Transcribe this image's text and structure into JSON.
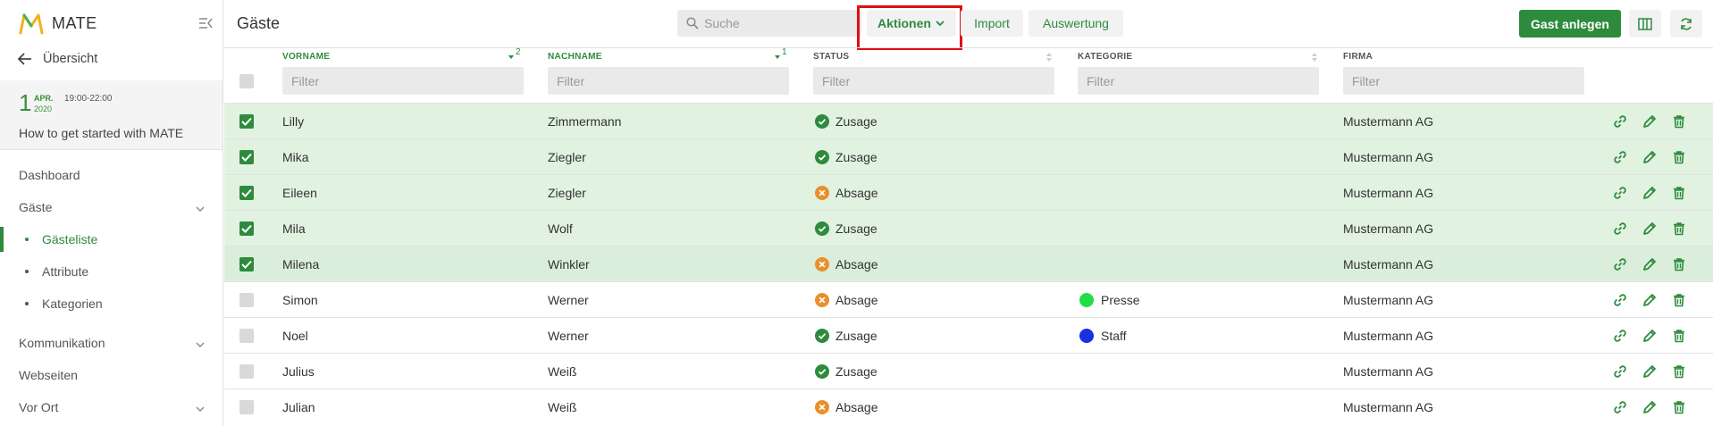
{
  "app": {
    "name": "MATE"
  },
  "sidebar": {
    "back_label": "Übersicht",
    "event": {
      "day": "1",
      "month": "APR.",
      "year": "2020",
      "time": "19:00-22:00",
      "title": "How to get started with MATE"
    },
    "items": [
      {
        "label": "Dashboard"
      },
      {
        "label": "Gäste"
      },
      {
        "label": "Gästeliste"
      },
      {
        "label": "Attribute"
      },
      {
        "label": "Kategorien"
      },
      {
        "label": "Kommunikation"
      },
      {
        "label": "Webseiten"
      },
      {
        "label": "Vor Ort"
      }
    ]
  },
  "header": {
    "title": "Gäste",
    "search_placeholder": "Suche",
    "aktionen_label": "Aktionen",
    "import_label": "Import",
    "auswertung_label": "Auswertung",
    "primary_label": "Gast anlegen"
  },
  "table": {
    "columns": [
      {
        "label": "VORNAME",
        "sort_order": "2"
      },
      {
        "label": "NACHNAME",
        "sort_order": "1"
      },
      {
        "label": "STATUS"
      },
      {
        "label": "KATEGORIE"
      },
      {
        "label": "FIRMA"
      }
    ],
    "filter_placeholder": "Filter",
    "rows": [
      {
        "vorname": "Lilly",
        "nachname": "Zimmermann",
        "status": "Zusage",
        "kategorie": "",
        "firma": "Mustermann AG",
        "selected": true
      },
      {
        "vorname": "Mika",
        "nachname": "Ziegler",
        "status": "Zusage",
        "kategorie": "",
        "firma": "Mustermann AG",
        "selected": true
      },
      {
        "vorname": "Eileen",
        "nachname": "Ziegler",
        "status": "Absage",
        "kategorie": "",
        "firma": "Mustermann AG",
        "selected": true
      },
      {
        "vorname": "Mila",
        "nachname": "Wolf",
        "status": "Zusage",
        "kategorie": "",
        "firma": "Mustermann AG",
        "selected": true
      },
      {
        "vorname": "Milena",
        "nachname": "Winkler",
        "status": "Absage",
        "kategorie": "",
        "firma": "Mustermann AG",
        "selected": true
      },
      {
        "vorname": "Simon",
        "nachname": "Werner",
        "status": "Absage",
        "kategorie": "Presse",
        "firma": "Mustermann AG",
        "selected": false
      },
      {
        "vorname": "Noel",
        "nachname": "Werner",
        "status": "Zusage",
        "kategorie": "Staff",
        "firma": "Mustermann AG",
        "selected": false
      },
      {
        "vorname": "Julius",
        "nachname": "Weiß",
        "status": "Zusage",
        "kategorie": "",
        "firma": "Mustermann AG",
        "selected": false
      },
      {
        "vorname": "Julian",
        "nachname": "Weiß",
        "status": "Absage",
        "kategorie": "",
        "firma": "Mustermann AG",
        "selected": false
      }
    ]
  },
  "colors": {
    "accent": "#2e8b3d",
    "zusage": "#2e8b3d",
    "absage": "#e8902c",
    "presse": "#22dd44",
    "staff": "#1a2fe0",
    "highlight": "#e01010"
  },
  "icons": {
    "row_actions": [
      "link-icon",
      "pencil-icon",
      "trash-icon"
    ],
    "header": [
      "columns-icon",
      "refresh-icon",
      "search-icon",
      "chevron-down-icon",
      "collapse-sidebar-icon",
      "arrow-left-icon"
    ]
  }
}
